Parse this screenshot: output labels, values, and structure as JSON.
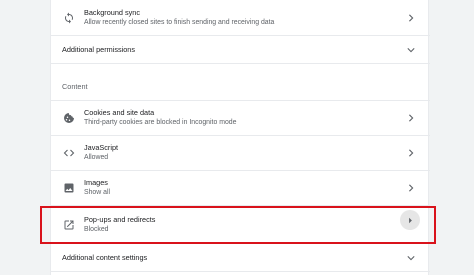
{
  "rows": {
    "background_sync": {
      "title": "Background sync",
      "sub": "Allow recently closed sites to finish sending and receiving data",
      "icon": "sync-icon"
    },
    "additional_permissions": {
      "title": "Additional permissions",
      "icon": "expand-chevron-icon"
    },
    "section": "Content",
    "cookies": {
      "title": "Cookies and site data",
      "sub": "Third-party cookies are blocked in Incognito mode",
      "icon": "cookie-icon"
    },
    "javascript": {
      "title": "JavaScript",
      "sub": "Allowed",
      "icon": "code-icon"
    },
    "images": {
      "title": "Images",
      "sub": "Show all",
      "icon": "image-icon"
    },
    "popups": {
      "title": "Pop-ups and redirects",
      "sub": "Blocked",
      "icon": "open-in-new-icon"
    },
    "additional_content": {
      "title": "Additional content settings",
      "icon": "expand-chevron-icon"
    }
  },
  "colors": {
    "highlight": "#d9121b",
    "text": "#202124",
    "secondary": "#5f6368"
  }
}
